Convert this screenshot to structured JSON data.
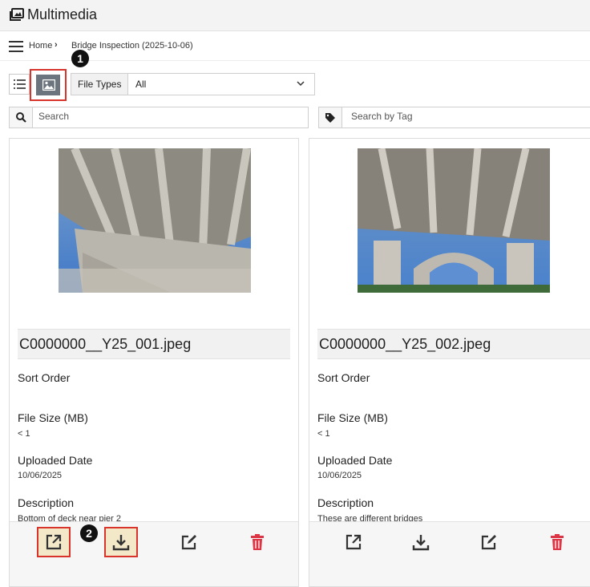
{
  "app": {
    "title": "Multimedia"
  },
  "breadcrumb": {
    "home": "Home",
    "current": "Bridge Inspection (2025-10-06)"
  },
  "toolbar": {
    "file_types_label": "File Types",
    "file_types_value": "All",
    "annotation_1": "1",
    "annotation_2": "2"
  },
  "search": {
    "placeholder": "Search",
    "tag_placeholder": "Search by Tag"
  },
  "labels": {
    "sort_order": "Sort Order",
    "file_size": "File Size (MB)",
    "uploaded_date": "Uploaded Date",
    "description": "Description"
  },
  "cards": [
    {
      "filename": "C0000000__Y25_001.jpeg",
      "file_size": "< 1",
      "uploaded_date": "10/06/2025",
      "description": "Bottom of deck near pier 2"
    },
    {
      "filename": "C0000000__Y25_002.jpeg",
      "file_size": "< 1",
      "uploaded_date": "10/06/2025",
      "description": "These are different bridges"
    }
  ],
  "colors": {
    "accent_red": "#d9342b",
    "delete_red": "#dc3545",
    "active_gray": "#6c757d"
  },
  "icons": [
    "multimedia-icon",
    "hamburger-icon",
    "list-icon",
    "image-icon",
    "chevron-down-icon",
    "search-icon",
    "tag-icon",
    "open-external-icon",
    "download-icon",
    "edit-icon",
    "trash-icon"
  ]
}
